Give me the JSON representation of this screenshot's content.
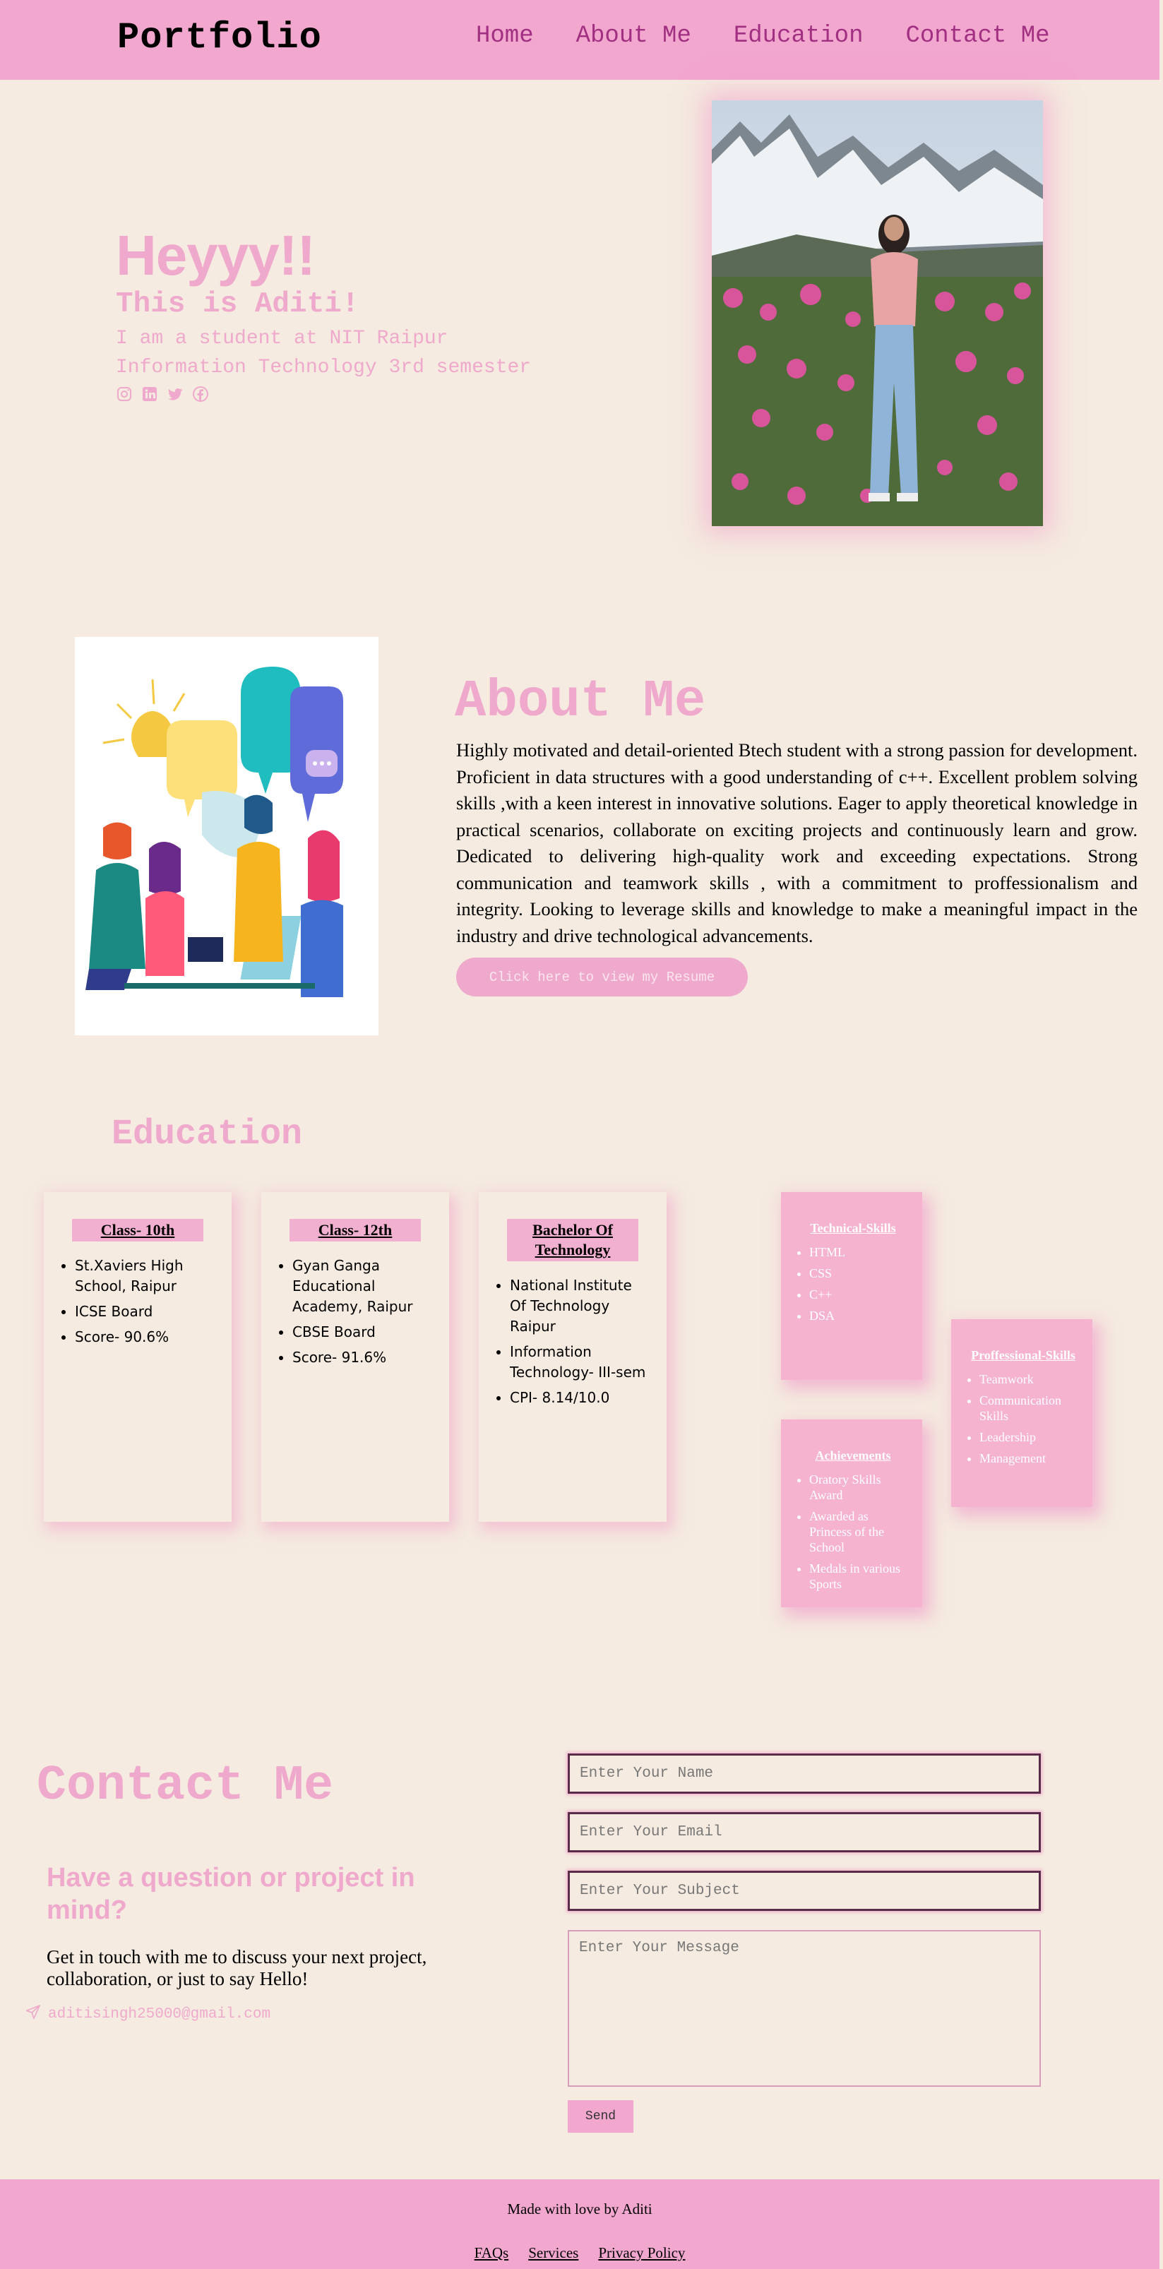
{
  "nav": {
    "brand": "Portfolio",
    "links": [
      "Home",
      "About Me",
      "Education",
      "Contact Me"
    ]
  },
  "hero": {
    "greeting": "Heyyy!!",
    "name_line": "This is Aditi!",
    "line1": "I am a student at NIT Raipur",
    "line2": "Information Technology 3rd semester",
    "social_icons": [
      "instagram-icon",
      "linkedin-icon",
      "twitter-icon",
      "facebook-icon"
    ]
  },
  "about": {
    "title": "About Me",
    "text": "Highly motivated and detail-oriented Btech student with a strong passion for development. Proficient in data structures with a good understanding of c++. Excellent problem solving skills ,with a keen interest in innovative solutions. Eager to apply theoretical knowledge in practical scenarios, collaborate on exciting projects and continuously learn and grow. Dedicated to delivering high-quality work and exceeding expectations. Strong communication and teamwork skills , with a commitment to proffessionalism and integrity. Looking to leverage skills and knowledge to make a meaningful impact in the industry and drive technological advancements.",
    "resume_button": "Click here to view my Resume"
  },
  "education": {
    "title": "Education",
    "cards": [
      {
        "title": "Class- 10th",
        "items": [
          "St.Xaviers High School, Raipur",
          "ICSE Board",
          "Score- 90.6%"
        ]
      },
      {
        "title": "Class- 12th",
        "items": [
          "Gyan Ganga Educational Academy, Raipur",
          "CBSE Board",
          "Score- 91.6%"
        ]
      },
      {
        "title": "Bachelor Of Technology",
        "items": [
          "National Institute Of Technology Raipur",
          "Information Technology- III-sem",
          "CPI- 8.14/10.0"
        ]
      }
    ],
    "technical": {
      "title": "Technical-Skills",
      "items": [
        "HTML",
        "CSS",
        "C++",
        "DSA"
      ]
    },
    "achievements": {
      "title": "Achievements",
      "items": [
        "Oratory Skills Award",
        "Awarded as Princess of the School",
        "Medals in various Sports"
      ]
    },
    "professional": {
      "title": "Proffessional-Skills",
      "items": [
        "Teamwork",
        "Communication Skills",
        "Leadership",
        "Management"
      ]
    }
  },
  "contact": {
    "title": "Contact Me",
    "subtitle": "Have a question or project in mind?",
    "text": "Get in touch with me to discuss your next project, collaboration, or just to say Hello!",
    "email": "aditisingh25000@gmail.com",
    "name_placeholder": "Enter Your Name",
    "email_placeholder": "Enter Your Email",
    "subject_placeholder": "Enter Your Subject",
    "message_placeholder": "Enter Your Message",
    "send_button": "Send"
  },
  "footer": {
    "text": "Made with love by Aditi",
    "links": [
      "FAQs",
      "Services",
      "Privacy Policy"
    ]
  },
  "colors": {
    "pink_primary": "#efa9cc",
    "nav_bg": "#f2a7cf",
    "nav_link": "#a12f82",
    "page_bg": "#f5ebe0"
  }
}
